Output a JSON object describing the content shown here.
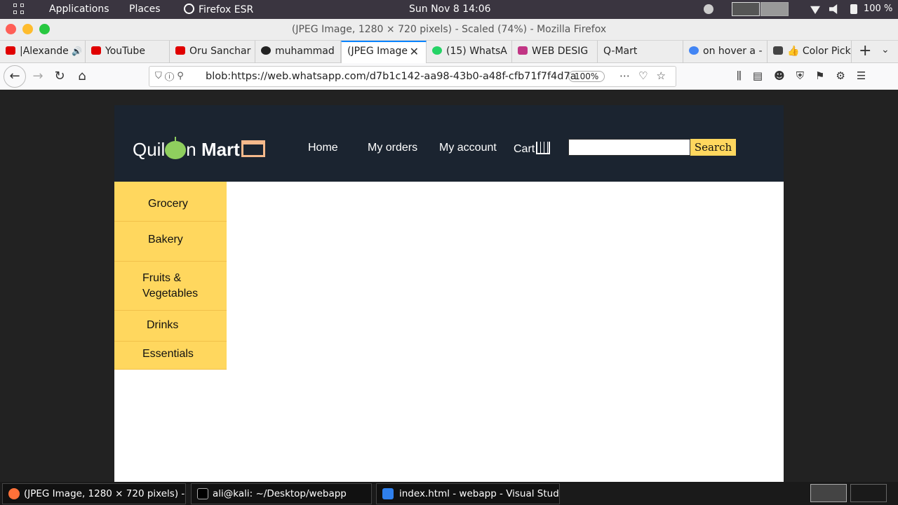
{
  "topbar": {
    "applications": "Applications",
    "places": "Places",
    "active_app": "Firefox ESR",
    "clock": "Sun Nov 8  14:06",
    "battery": "100 %"
  },
  "window": {
    "title": "(JPEG Image, 1280 × 720 pixels) - Scaled (74%) - Mozilla Firefox"
  },
  "tabs": [
    {
      "label": "|Alexande",
      "icon_color": "#e00000"
    },
    {
      "label": "YouTube",
      "icon_color": "#e00000"
    },
    {
      "label": "Oru Sanchar",
      "icon_color": "#e00000"
    },
    {
      "label": "muhammad",
      "icon_color": "#222222"
    },
    {
      "label": "(JPEG Image",
      "icon_color": "#ffffff"
    },
    {
      "label": "(15) WhatsA",
      "icon_color": "#25d366"
    },
    {
      "label": "WEB DESIG",
      "icon_color": "#c13584"
    },
    {
      "label": "Q-Mart",
      "icon_color": "#ededed"
    },
    {
      "label": "on hover a -",
      "icon_color": "#4285f4"
    },
    {
      "label": "👍 Color Pick",
      "icon_color": "#444444"
    }
  ],
  "toolbar": {
    "url": "blob:https://web.whatsapp.com/d7b1c142-aa98-43b0-a48f-cfb71f7f4d7a",
    "zoom": "100%"
  },
  "site": {
    "logo_left": "Quil",
    "logo_right": "n ",
    "logo_bold": "Mart",
    "nav": {
      "home": "Home",
      "orders": "My orders",
      "account": "My account",
      "cart": "Cart"
    },
    "search_value": "",
    "search_button": "Search",
    "categories": [
      "Grocery",
      "Bakery",
      "Fruits & Vegetables",
      "Drinks",
      "Essentials"
    ],
    "colors": {
      "header": "#1b2430",
      "accent": "#ffd75e"
    }
  },
  "taskbar": {
    "items": [
      "(JPEG Image, 1280 × 720 pixels) - ...",
      "ali@kali: ~/Desktop/webapp",
      "index.html - webapp - Visual Stud..."
    ]
  }
}
